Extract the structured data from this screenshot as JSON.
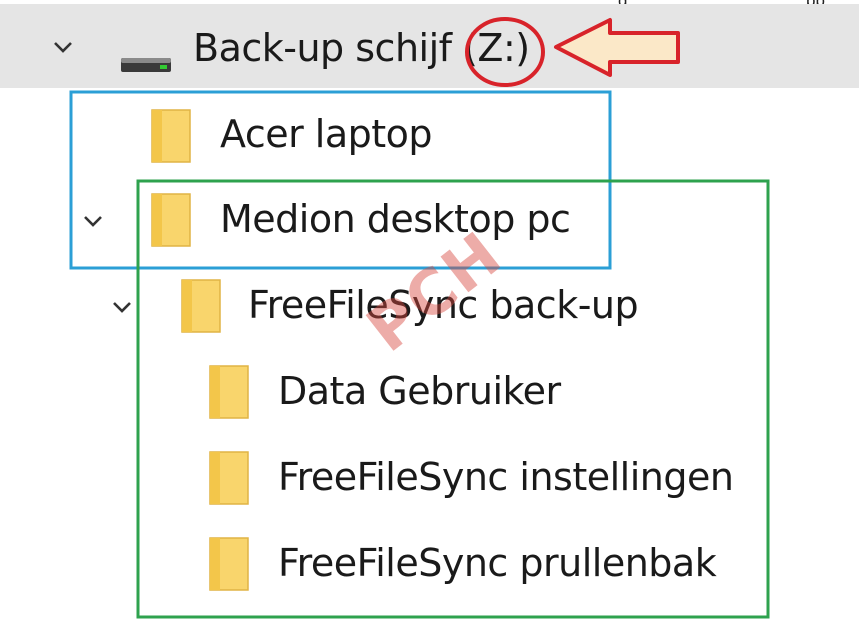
{
  "top_caption": "g",
  "top_caption_right": "pp",
  "tree": {
    "drive": {
      "label": "Back-up schijf (Z:)",
      "expanded": true,
      "icon": "drive-icon"
    },
    "items": [
      {
        "label": "Acer laptop",
        "icon": "folder-icon",
        "level": 1,
        "expanded": false
      },
      {
        "label": "Medion desktop pc",
        "icon": "folder-icon",
        "level": 1,
        "expanded": true
      },
      {
        "label": "FreeFileSync back-up",
        "icon": "folder-icon",
        "level": 2,
        "expanded": true
      },
      {
        "label": "Data Gebruiker",
        "icon": "folder-icon",
        "level": 3,
        "expanded": false
      },
      {
        "label": "FreeFileSync instellingen",
        "icon": "folder-icon",
        "level": 3,
        "expanded": false
      },
      {
        "label": "FreeFileSync prullenbak",
        "icon": "folder-icon",
        "level": 3,
        "expanded": false
      }
    ]
  },
  "annotations": {
    "watermark": "PCH",
    "highlight_circle_color": "#d8232a",
    "arrow_fill": "#fbe8c8",
    "arrow_stroke": "#d8232a",
    "blue_box_color": "#2b9fd6",
    "green_box_color": "#2ea24e"
  },
  "colors": {
    "folder_fill": "#f9d56c",
    "folder_tab": "#f3c64a",
    "selected_row": "#e5e5e5",
    "chevron": "#333333"
  }
}
